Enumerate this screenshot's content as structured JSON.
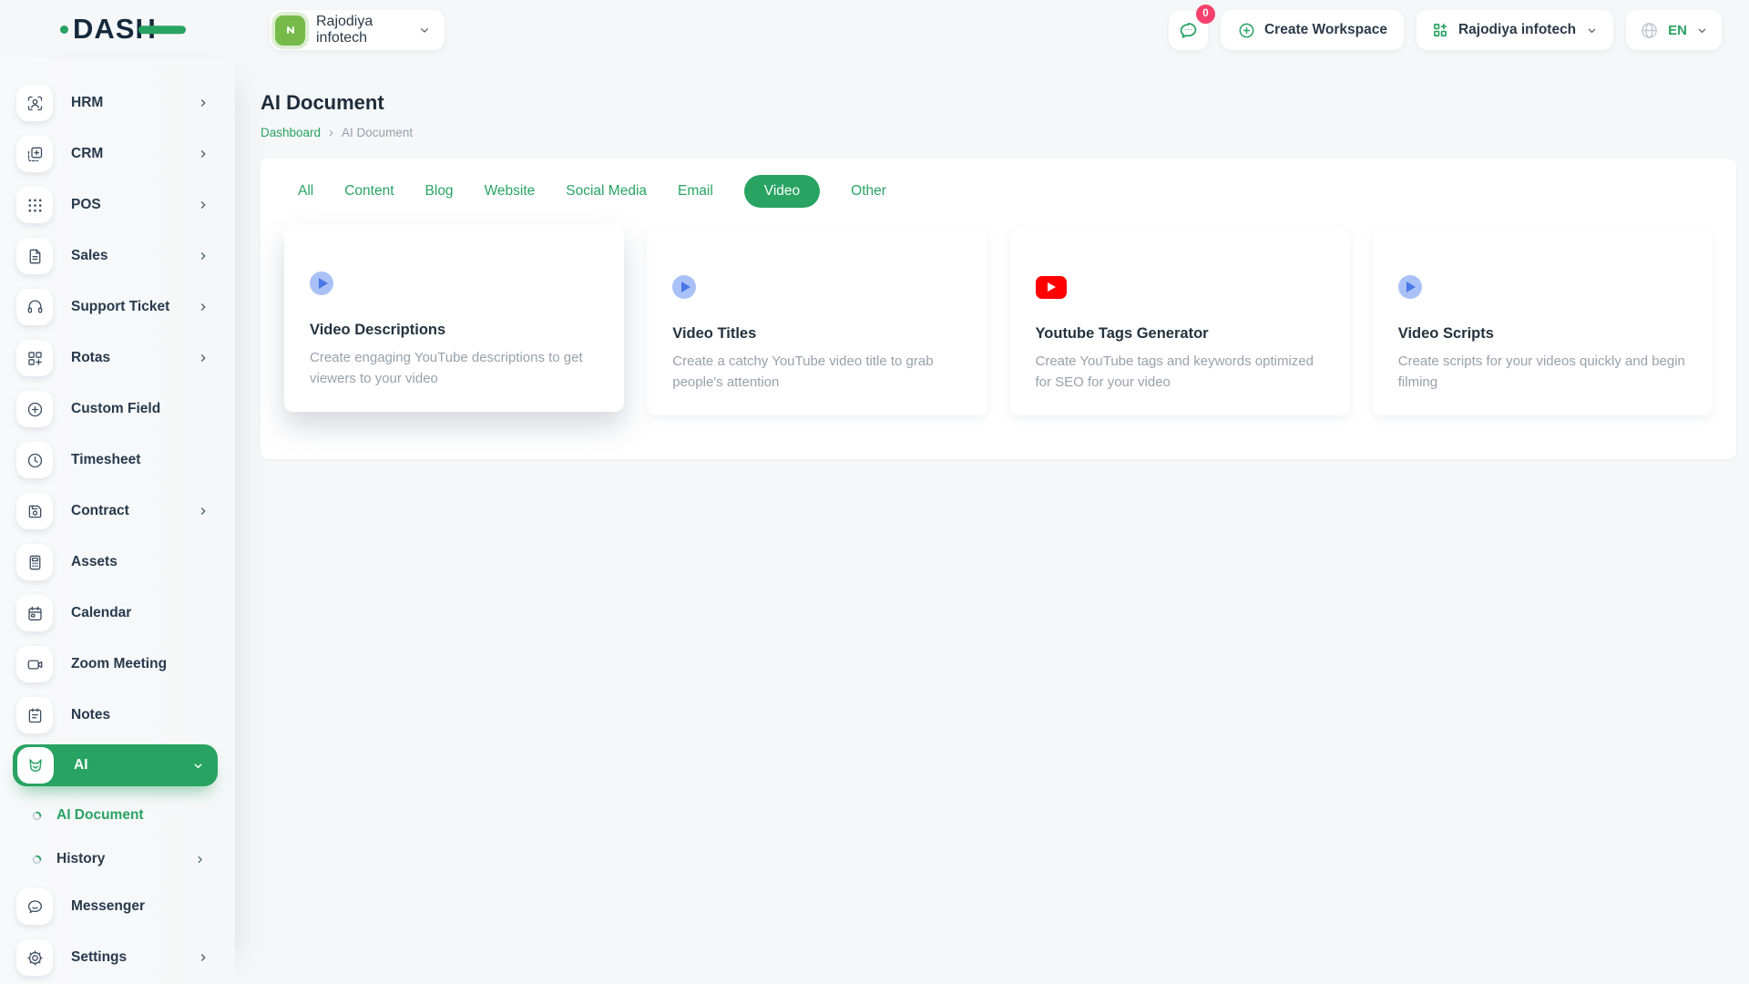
{
  "brand": {
    "name": "DASH"
  },
  "header": {
    "workspace_switcher": {
      "label": "Rajodiya infotech"
    },
    "messages_button": {
      "badge_count": "0"
    },
    "create_workspace_button": {
      "label": "Create Workspace"
    },
    "company_menu": {
      "label": "Rajodiya infotech"
    },
    "language_menu": {
      "label": "EN"
    }
  },
  "sidebar": {
    "items": [
      {
        "label": "HRM"
      },
      {
        "label": "CRM"
      },
      {
        "label": "POS"
      },
      {
        "label": "Sales"
      },
      {
        "label": "Support Ticket"
      },
      {
        "label": "Rotas"
      },
      {
        "label": "Custom Field"
      },
      {
        "label": "Timesheet"
      },
      {
        "label": "Contract"
      },
      {
        "label": "Assets"
      },
      {
        "label": "Calendar"
      },
      {
        "label": "Zoom Meeting"
      },
      {
        "label": "Notes"
      }
    ],
    "ai_menu": {
      "label": "AI",
      "children": [
        {
          "label": "AI Document",
          "active": true
        },
        {
          "label": "History"
        }
      ]
    },
    "footer_items": [
      {
        "label": "Messenger"
      },
      {
        "label": "Settings"
      }
    ]
  },
  "page": {
    "title": "AI Document",
    "breadcrumb": {
      "root": "Dashboard",
      "current": "AI Document"
    }
  },
  "icons": {
    "breadcrumb_separator": "›"
  },
  "tabs": [
    {
      "label": "All"
    },
    {
      "label": "Content"
    },
    {
      "label": "Blog"
    },
    {
      "label": "Website"
    },
    {
      "label": "Social Media"
    },
    {
      "label": "Email"
    },
    {
      "label": "Video",
      "active": true
    },
    {
      "label": "Other"
    }
  ],
  "cards": [
    {
      "icon": "play-circle-icon",
      "title": "Video Descriptions",
      "description": "Create engaging YouTube descriptions to get viewers to your video"
    },
    {
      "icon": "play-circle-icon",
      "title": "Video Titles",
      "description": "Create a catchy YouTube video title to grab people's attention"
    },
    {
      "icon": "youtube-icon",
      "title": "Youtube Tags Generator",
      "description": "Create YouTube tags and keywords optimized for SEO for your video"
    },
    {
      "icon": "play-circle-icon",
      "title": "Video Scripts",
      "description": "Create scripts for your videos quickly and begin filming"
    }
  ],
  "colors": {
    "accent_green": "#28A362",
    "badge_pink": "#F7406C",
    "youtube_red": "#FF0000",
    "play_icon_bg": "#A9C1F6",
    "play_icon_fg": "#4A77E8",
    "workspace_logo_green": "#76BB4A",
    "text_dark": "#24333F",
    "text_muted": "#98A1AB",
    "page_bg": "#F6F7F8"
  }
}
